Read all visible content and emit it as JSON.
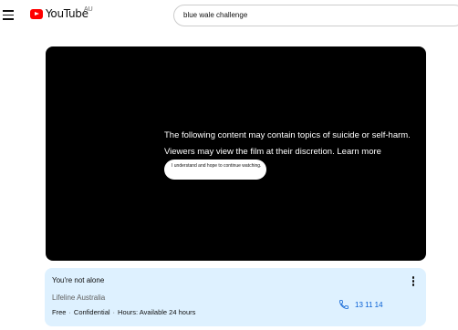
{
  "header": {
    "logo_text": "YouTube",
    "region": "AU",
    "search_query": "blue wale challenge"
  },
  "player": {
    "warning_line1": "The following content may contain topics of suicide or self-harm.",
    "warning_line2_prefix": "Viewers may view the film at their discretion.",
    "learn_more": "Learn more",
    "proceed_button": "I understand and hope to continue watching."
  },
  "support_panel": {
    "title": "You're not alone",
    "organisation": "Lifeline Australia",
    "details": [
      "Free",
      "Confidential",
      "Hours: Available 24 hours"
    ],
    "phone": "13 11 14"
  },
  "colors": {
    "brand_red": "#ff0000",
    "panel_bg": "#def1ff",
    "link_blue": "#065fd4"
  }
}
